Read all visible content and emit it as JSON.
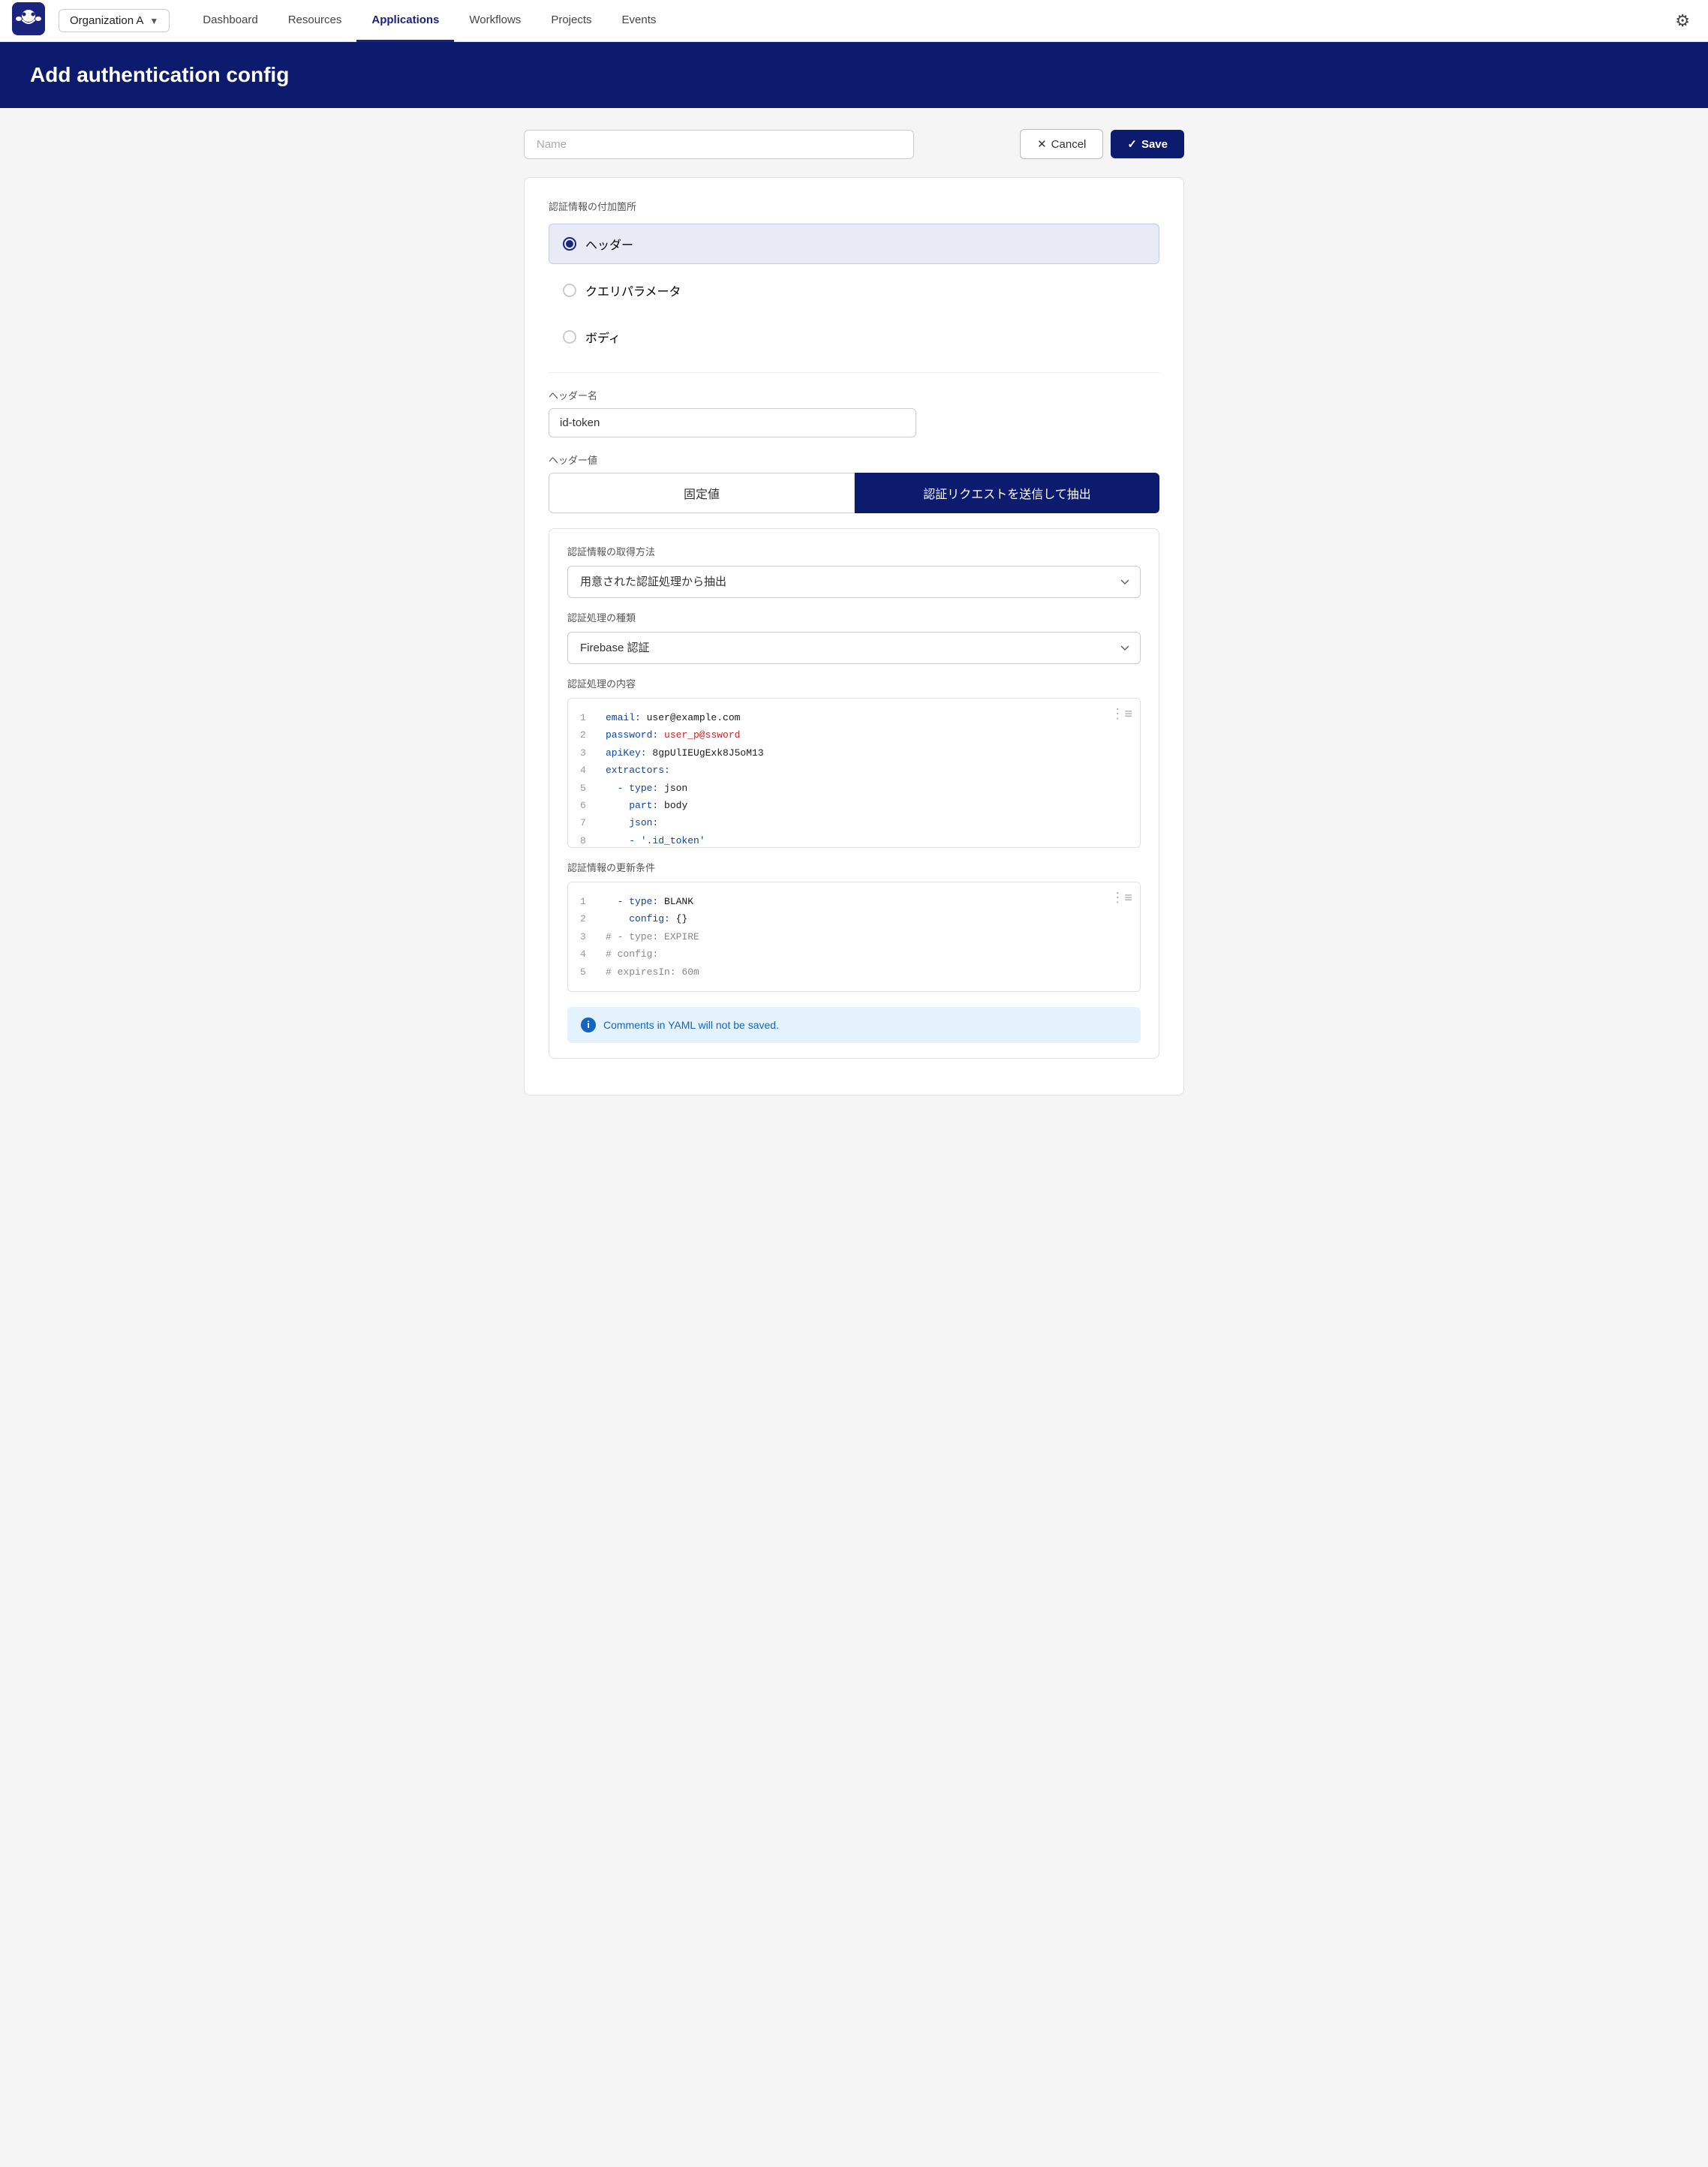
{
  "navbar": {
    "org_name": "Organization A",
    "links": [
      {
        "label": "Dashboard",
        "active": false
      },
      {
        "label": "Resources",
        "active": false
      },
      {
        "label": "Applications",
        "active": true
      },
      {
        "label": "Workflows",
        "active": false
      },
      {
        "label": "Projects",
        "active": false
      },
      {
        "label": "Events",
        "active": false
      }
    ]
  },
  "page_header": {
    "title": "Add authentication config"
  },
  "top_bar": {
    "name_placeholder": "Name",
    "cancel_label": "Cancel",
    "save_label": "Save"
  },
  "form": {
    "auth_location_label": "認証情報の付加箇所",
    "radio_options": [
      {
        "label": "ヘッダー",
        "selected": true
      },
      {
        "label": "クエリパラメータ",
        "selected": false
      },
      {
        "label": "ボディ",
        "selected": false
      }
    ],
    "header_name_label": "ヘッダー名",
    "header_name_value": "id-token",
    "header_value_label": "ヘッダー値",
    "toggle_fixed": "固定値",
    "toggle_extract": "認証リクエストを送信して抽出",
    "inner_card": {
      "acquisition_label": "認証情報の取得方法",
      "acquisition_value": "用意された認証処理から抽出",
      "auth_type_label": "認証処理の種類",
      "auth_type_value": "Firebase 認証",
      "auth_content_label": "認証処理の内容",
      "auth_code_lines": [
        {
          "num": "1",
          "code": "  email: user@example.com"
        },
        {
          "num": "2",
          "code": "  password: user_p@ssword"
        },
        {
          "num": "3",
          "code": "  apiKey: 8gpUlIEUgExk8J5oM13"
        },
        {
          "num": "4",
          "code": "  extractors:"
        },
        {
          "num": "5",
          "code": "    - type: json"
        },
        {
          "num": "6",
          "code": "      part: body"
        },
        {
          "num": "7",
          "code": "      json:"
        },
        {
          "num": "8",
          "code": "      - '.id_token'"
        }
      ],
      "update_conditions_label": "認証情報の更新条件",
      "update_code_lines": [
        {
          "num": "1",
          "code": "  - type: BLANK"
        },
        {
          "num": "2",
          "code": "    config: {}"
        },
        {
          "num": "3",
          "code": "#  - type: EXPIRE"
        },
        {
          "num": "4",
          "code": "#    config:"
        },
        {
          "num": "5",
          "code": "#      expiresIn: 60m"
        }
      ]
    },
    "notice": "Comments in YAML will not be saved."
  }
}
